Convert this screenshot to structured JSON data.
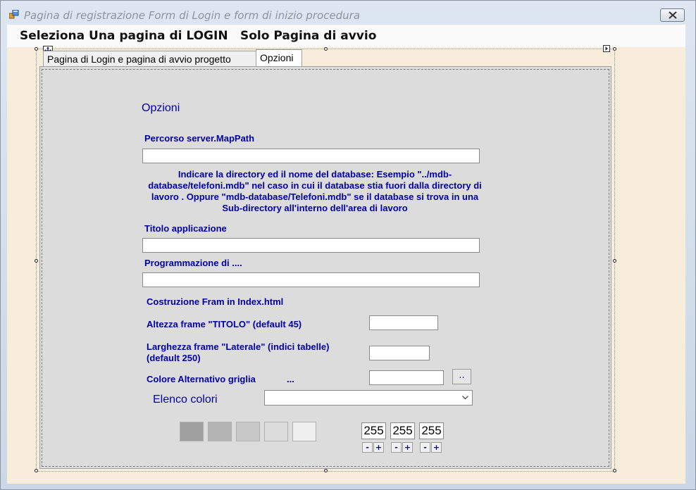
{
  "window": {
    "title": "Pagina di registrazione Form di Login  e form di inizio procedura",
    "close_label": "✕"
  },
  "menu": {
    "items": [
      "Seleziona Una pagina di LOGIN",
      "Solo Pagina di avvio"
    ]
  },
  "tabs": [
    {
      "label": "Pagina di Login e pagina di avvio progetto",
      "active": false
    },
    {
      "label": "Opzioni",
      "active": true
    }
  ],
  "options": {
    "heading": "Opzioni",
    "mappath_label": "Percorso server.MapPath",
    "mappath_value": "",
    "mappath_note": "Indicare la directory ed il nome del database: Esempio \"../mdb-database/telefoni.mdb\" nel caso in cui il database stia fuori dalla directory di lavoro .  Oppure \"mdb-database/Telefoni.mdb\" se il database si trova in una  Sub-directory all'interno dell'area di lavoro",
    "app_title_label": "Titolo applicazione",
    "app_title_value": "",
    "programming_label": "Programmazione di ....",
    "programming_value": "",
    "frame_section_label": "Costruzione Fram in Index.html",
    "title_height_label": "Altezza frame \"TITOLO\" (default 45)",
    "title_height_value": "",
    "side_width_label": "Larghezza  frame \"Laterale\" (indici tabelle) (default 250)",
    "side_width_value": "",
    "alt_color_label": "Colore Alternativo griglia",
    "alt_color_ellipsis": "...",
    "alt_color_value": "",
    "alt_color_button": "..",
    "color_list_label": "Elenco colori",
    "color_list_selected": "",
    "swatches": [
      "#a0a0a0",
      "#b4b4b4",
      "#c8c8c8",
      "#dcdcdc",
      "#f0f0f0"
    ],
    "rgb": [
      {
        "value": "255",
        "minus": "-",
        "plus": "+"
      },
      {
        "value": "255",
        "minus": "-",
        "plus": "+"
      },
      {
        "value": "255",
        "minus": "-",
        "plus": "+"
      }
    ]
  },
  "colors": {
    "label_blue": "#0000a0",
    "panel_bg": "#dcdcdc",
    "client_bg": "#f8ecda"
  }
}
